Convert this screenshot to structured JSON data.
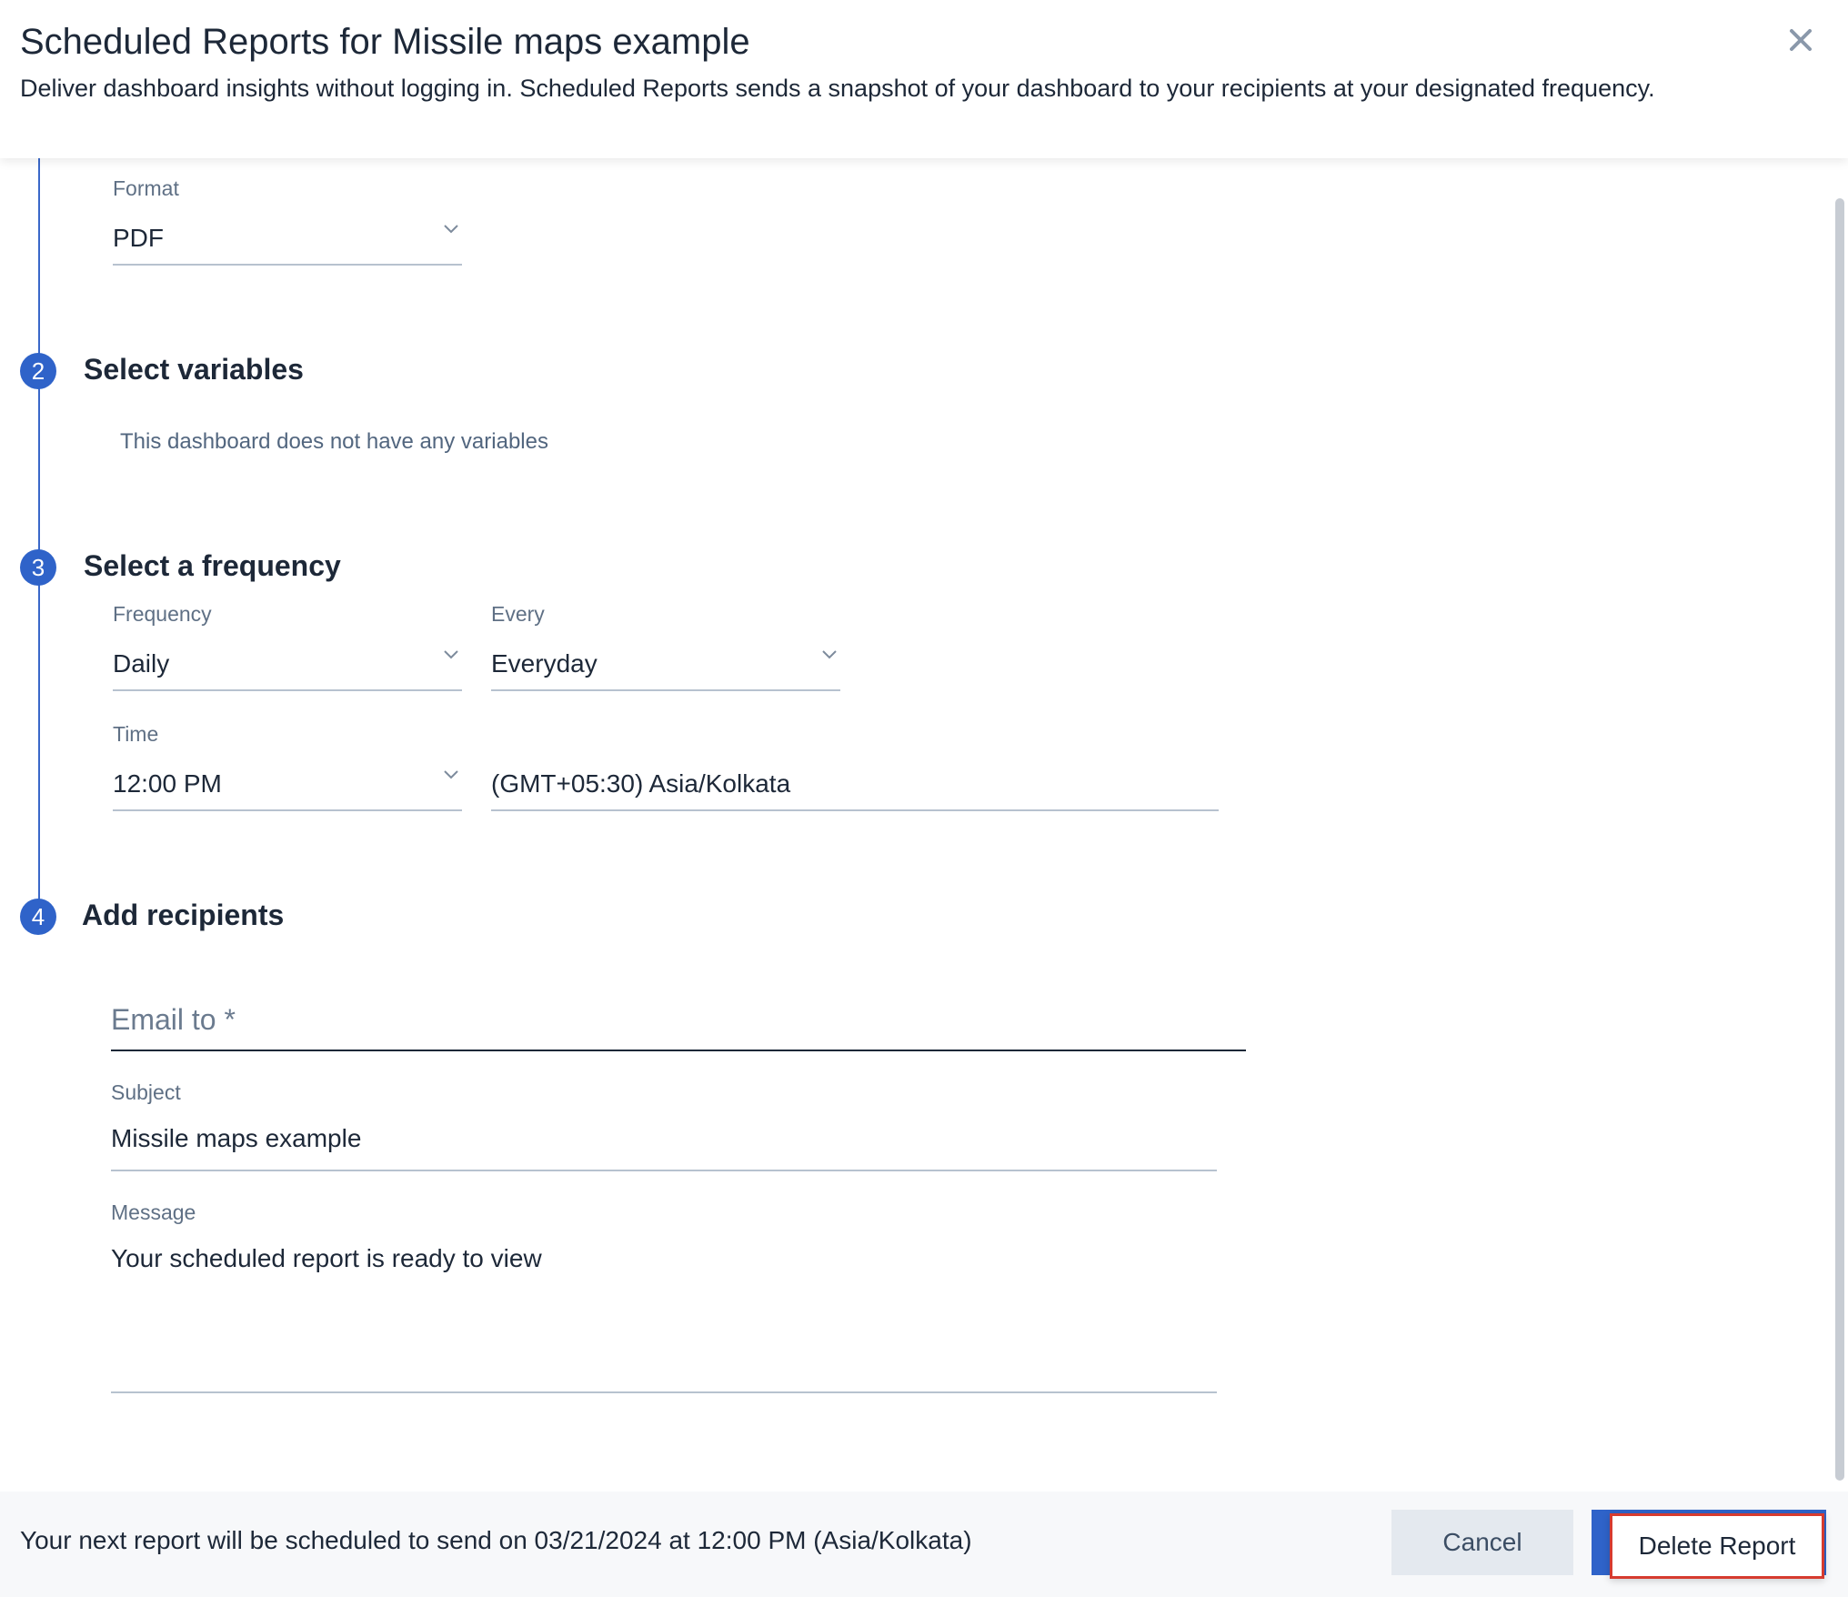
{
  "header": {
    "title": "Scheduled Reports for Missile maps example",
    "subtitle": "Deliver dashboard insights without logging in. Scheduled Reports sends a snapshot of your dashboard to your recipients at your designated frequency."
  },
  "format": {
    "label": "Format",
    "value": "PDF"
  },
  "step2": {
    "number": "2",
    "title": "Select variables",
    "note": "This dashboard does not have any variables"
  },
  "step3": {
    "number": "3",
    "title": "Select a frequency",
    "frequency_label": "Frequency",
    "frequency_value": "Daily",
    "every_label": "Every",
    "every_value": "Everyday",
    "time_label": "Time",
    "time_value": "12:00 PM",
    "timezone_value": "(GMT+05:30) Asia/Kolkata"
  },
  "step4": {
    "number": "4",
    "title": "Add recipients",
    "email_placeholder": "Email to *",
    "subject_label": "Subject",
    "subject_value": "Missile maps example",
    "message_label": "Message",
    "message_value": "Your scheduled report is ready to view"
  },
  "footer": {
    "next_report_text": "Your next report will be scheduled to send on 03/21/2024 at 12:00 PM (Asia/Kolkata)",
    "cancel_label": "Cancel",
    "delete_label": "Delete Report"
  },
  "colors": {
    "accent": "#2f63c9",
    "delete_outline": "#d63b2f"
  },
  "icons": {
    "close": "close-icon",
    "chevron": "chevron-down-icon"
  }
}
